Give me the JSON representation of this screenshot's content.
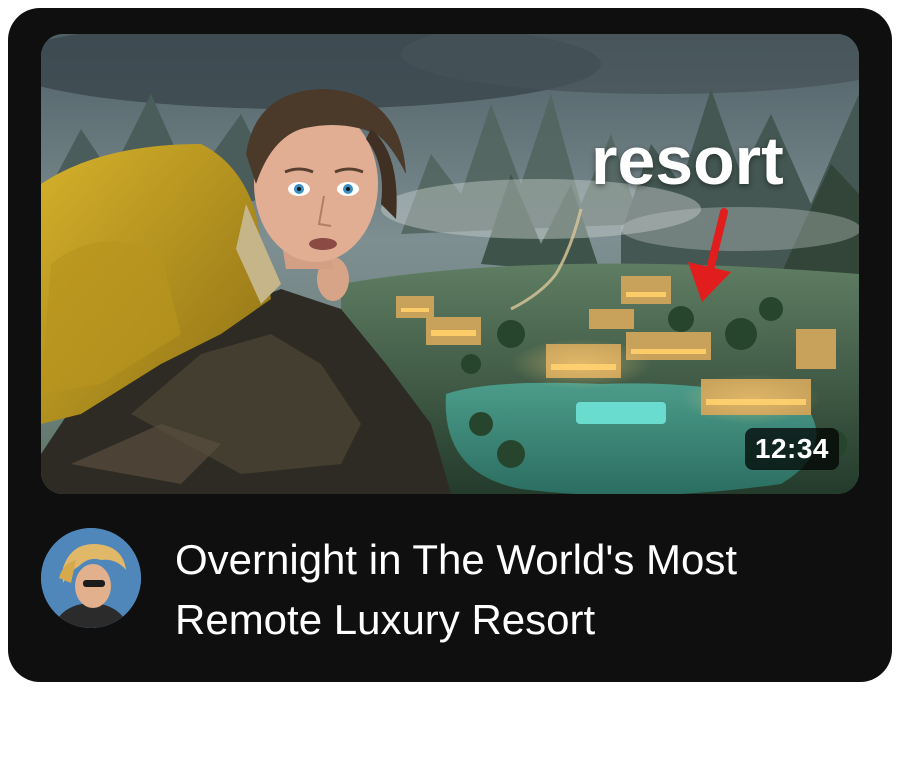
{
  "video": {
    "title": "Overnight in The World's Most Remote Luxury Resort",
    "duration": "12:34",
    "thumbnail_overlay_text": "resort"
  },
  "channel": {
    "avatar_icon": "channel-avatar"
  },
  "colors": {
    "card_background": "#0f0f10",
    "text": "#ffffff",
    "arrow": "#e11d1d",
    "duration_badge": "#000000"
  }
}
